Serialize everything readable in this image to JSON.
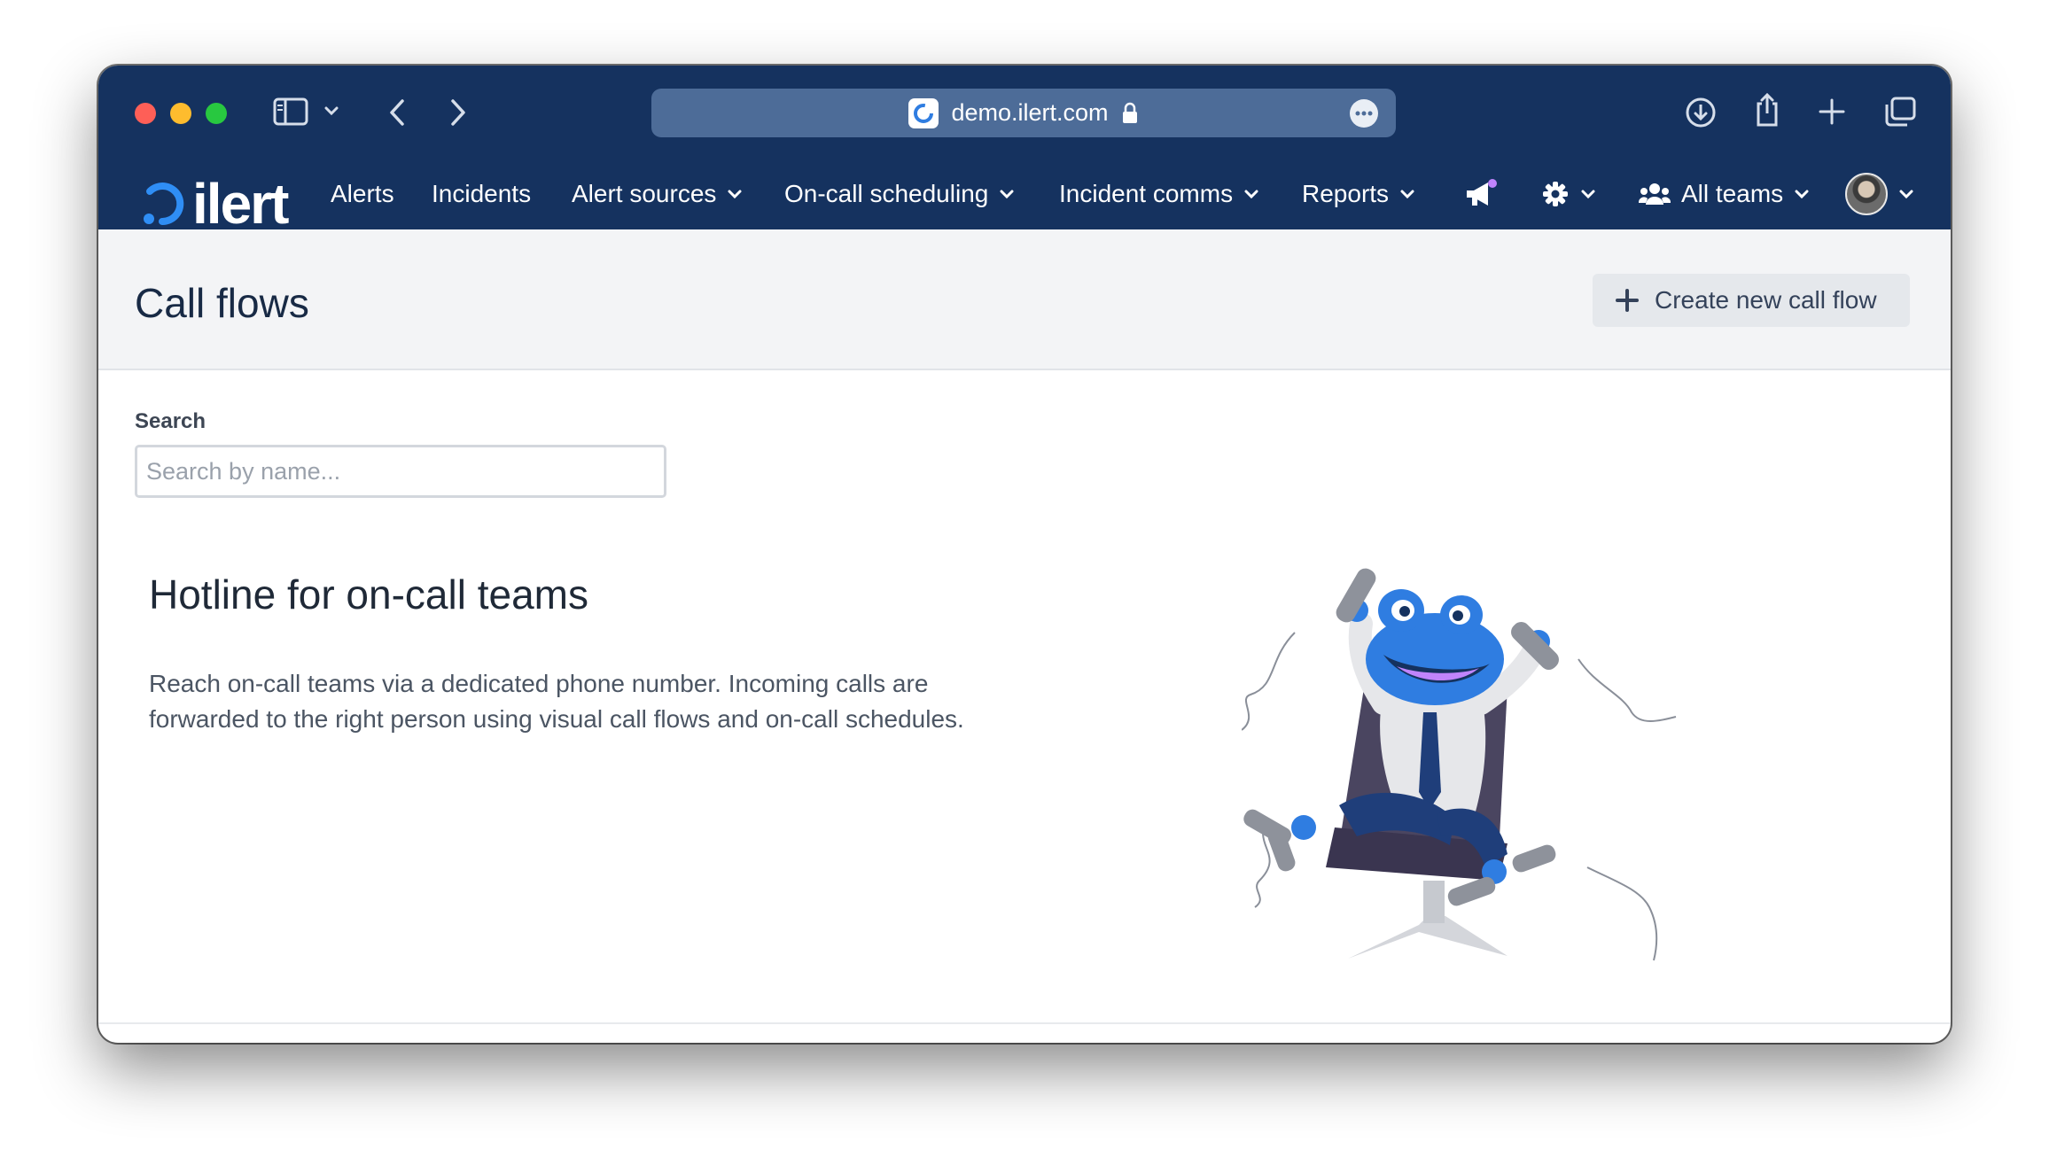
{
  "browser": {
    "url": "demo.ilert.com",
    "icons": [
      "sidebar-icon",
      "chevron-down-icon",
      "back-icon",
      "forward-icon",
      "lock-icon",
      "more-icon",
      "download-icon",
      "share-icon",
      "new-tab-icon",
      "tabs-overview-icon"
    ]
  },
  "nav": {
    "logo": "ilert",
    "items": {
      "alerts": "Alerts",
      "incidents": "Incidents",
      "alert_sources": "Alert sources",
      "on_call": "On-call scheduling",
      "incident_comms": "Incident comms",
      "reports": "Reports",
      "teams": "All teams"
    },
    "icons": [
      "megaphone-icon",
      "gear-icon",
      "users-icon",
      "avatar"
    ]
  },
  "header": {
    "title": "Call flows",
    "create_button": "Create new call flow"
  },
  "search": {
    "label": "Search",
    "placeholder": "Search by name..."
  },
  "empty_state": {
    "title": "Hotline for on-call teams",
    "description": "Reach on-call teams via a dedicated phone number. Incoming calls are forwarded to the right person using visual call flows and on-call schedules."
  },
  "colors": {
    "navbar": "#15325f",
    "urlbar": "#4d6c98",
    "header_bg": "#f3f4f6",
    "accent_blue": "#2f7de1"
  }
}
